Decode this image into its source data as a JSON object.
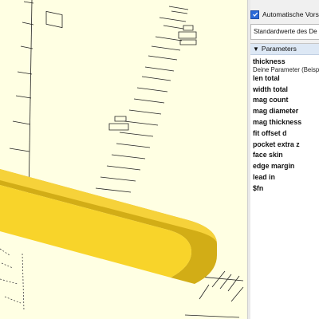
{
  "preview": {
    "auto_preview_label": "Automatische Vorscha",
    "auto_preview_checked": true
  },
  "presets": {
    "selected": "Standardwerte des De"
  },
  "parameters": {
    "header": "Parameters",
    "description": "Deine Parameter (Beisp",
    "items": [
      "thickness",
      "len total",
      "width total",
      "mag count",
      "mag diameter",
      "mag thickness",
      "fit offset d",
      "pocket extra z",
      "face skin",
      "edge margin",
      "lead in",
      "$fn"
    ]
  },
  "colors": {
    "viewport_bg": "#ffffe3",
    "model_fill": "#f8d42a",
    "model_side": "#d2ad16",
    "panel_bg": "#f0f0f0",
    "param_header_bg": "#dde8f5"
  }
}
